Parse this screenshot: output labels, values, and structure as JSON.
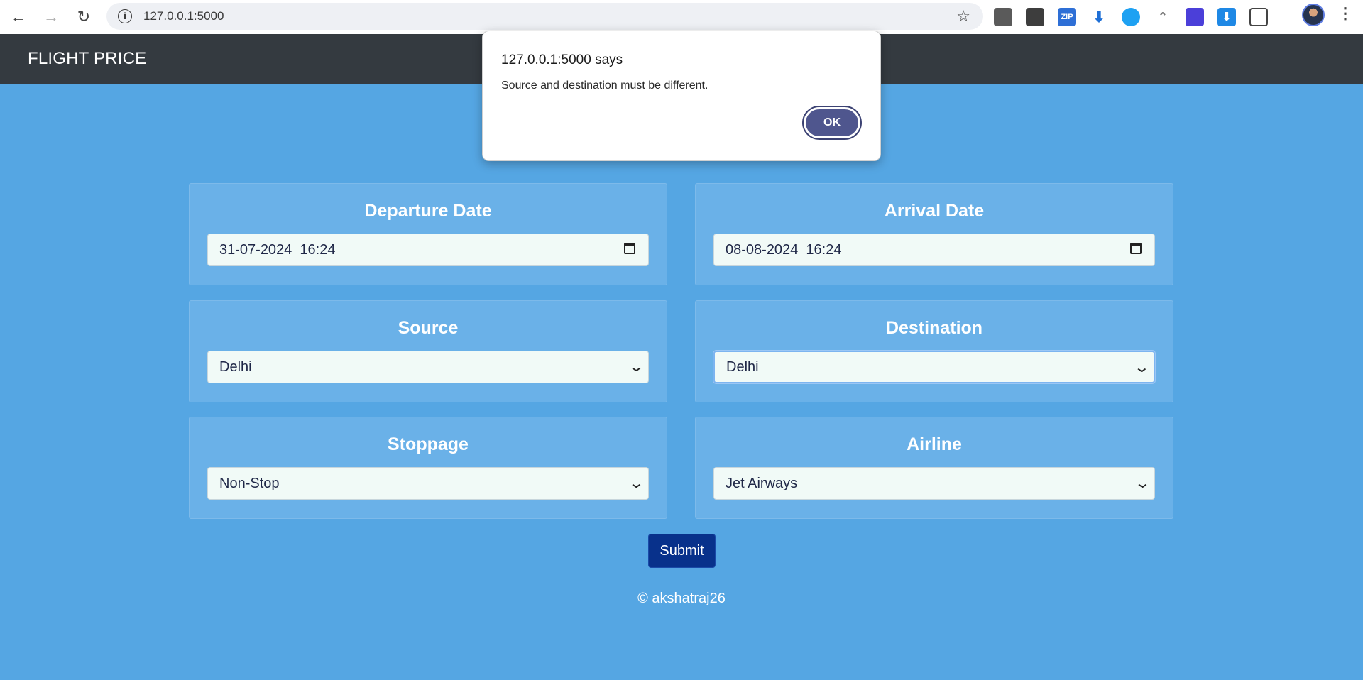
{
  "browser": {
    "url": "127.0.0.1:5000",
    "extensions": [
      {
        "name": "robot-extension-icon",
        "glyph": "",
        "bg": "#5a5a5a"
      },
      {
        "name": "download-box-extension-icon",
        "glyph": "",
        "bg": "#3d3d3d"
      },
      {
        "name": "zip-extension-icon",
        "glyph": "ZIP",
        "bg": "#2e6fd6"
      },
      {
        "name": "download-arrow-extension-icon",
        "glyph": "",
        "bg": "#ffffff"
      },
      {
        "name": "bird-extension-icon",
        "glyph": "",
        "bg": "#1ea1f2"
      },
      {
        "name": "crow-extension-icon",
        "glyph": "",
        "bg": "#ffffff"
      },
      {
        "name": "flag-extension-icon",
        "glyph": "",
        "bg": "#4b3fd9"
      },
      {
        "name": "save-extension-icon",
        "glyph": "",
        "bg": "#1e88e5"
      },
      {
        "name": "puzzle-extension-icon",
        "glyph": "",
        "bg": "#ffffff"
      }
    ]
  },
  "navbar": {
    "brand": "FLIGHT PRICE"
  },
  "form": {
    "departure": {
      "label": "Departure Date",
      "value": "31-07-2024  16:24"
    },
    "arrival": {
      "label": "Arrival Date",
      "value": "08-08-2024  16:24"
    },
    "source": {
      "label": "Source",
      "value": "Delhi"
    },
    "destination": {
      "label": "Destination",
      "value": "Delhi"
    },
    "stoppage": {
      "label": "Stoppage",
      "value": "Non-Stop"
    },
    "airline": {
      "label": "Airline",
      "value": "Jet Airways"
    },
    "submit_label": "Submit"
  },
  "footer": {
    "text": "© akshatraj26"
  },
  "dialog": {
    "title": "127.0.0.1:5000 says",
    "message": "Source and destination must be different.",
    "ok_label": "OK"
  }
}
